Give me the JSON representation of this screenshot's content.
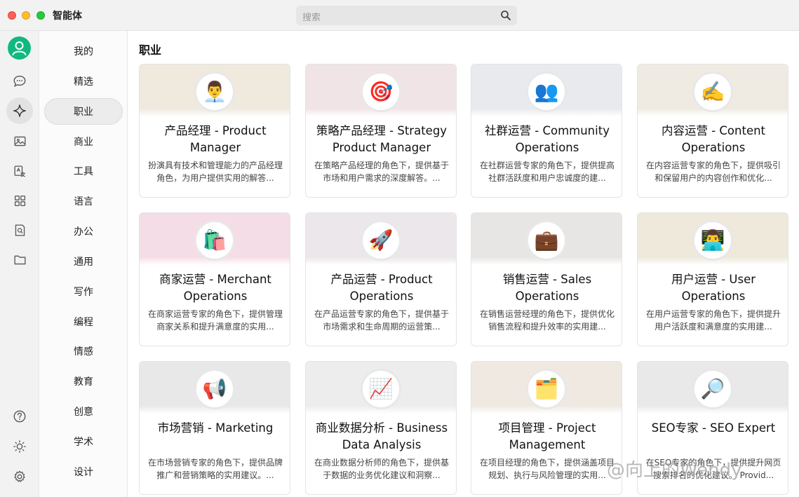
{
  "app": {
    "title": "智能体"
  },
  "search": {
    "placeholder": "搜索"
  },
  "rail": {
    "icons": [
      "avatar-icon",
      "chat-icon",
      "sparkle-icon",
      "image-icon",
      "translate-icon",
      "grid-icon",
      "search-doc-icon",
      "folder-icon",
      "help-icon",
      "sun-icon",
      "gear-icon"
    ],
    "accent": "#10b981"
  },
  "categories": [
    {
      "label": "我的"
    },
    {
      "label": "精选"
    },
    {
      "label": "职业",
      "active": true
    },
    {
      "label": "商业"
    },
    {
      "label": "工具"
    },
    {
      "label": "语言"
    },
    {
      "label": "办公"
    },
    {
      "label": "通用"
    },
    {
      "label": "写作"
    },
    {
      "label": "编程"
    },
    {
      "label": "情感"
    },
    {
      "label": "教育"
    },
    {
      "label": "创意"
    },
    {
      "label": "学术"
    },
    {
      "label": "设计"
    }
  ],
  "main": {
    "section_title": "职业"
  },
  "cards": [
    {
      "emoji": "👨‍💼",
      "banner": "#efe9de",
      "title": "产品经理 - Product Manager",
      "desc": "扮演具有技术和管理能力的产品经理角色，为用户提供实用的解答..."
    },
    {
      "emoji": "🎯",
      "banner": "#f1e4e6",
      "title": "策略产品经理 - Strategy Product Manager",
      "desc": "在策略产品经理的角色下，提供基于市场和用户需求的深度解答。..."
    },
    {
      "emoji": "👥",
      "banner": "#e8eaed",
      "title": "社群运营 - Community Operations",
      "desc": "在社群运营专家的角色下，提供提高社群活跃度和用户忠诚度的建..."
    },
    {
      "emoji": "✍️",
      "banner": "#efebe2",
      "title": "内容运营 - Content Operations",
      "desc": "在内容运营专家的角色下，提供吸引和保留用户的内容创作和优化..."
    },
    {
      "emoji": "🛍️",
      "banner": "#f4dde6",
      "title": "商家运营 - Merchant Operations",
      "desc": "在商家运营专家的角色下，提供管理商家关系和提升满意度的实用..."
    },
    {
      "emoji": "🚀",
      "banner": "#ece7ea",
      "title": "产品运营 - Product Operations",
      "desc": "在产品运营专家的角色下，提供基于市场需求和生命周期的运营策..."
    },
    {
      "emoji": "💼",
      "banner": "#e8e6e4",
      "title": "销售运营 - Sales Operations",
      "desc": "在销售运营经理的角色下，提供优化销售流程和提升效率的实用建..."
    },
    {
      "emoji": "👨‍💻",
      "banner": "#efe9dc",
      "title": "用户运营 - User Operations",
      "desc": "在用户运营专家的角色下，提供提升用户活跃度和满意度的实用建..."
    },
    {
      "emoji": "📢",
      "banner": "#e8e8e8",
      "title": "市场营销 - Marketing",
      "desc": "在市场营销专家的角色下，提供品牌推广和营销策略的实用建议。..."
    },
    {
      "emoji": "📈",
      "banner": "#ededed",
      "title": "商业数据分析 - Business Data Analysis",
      "desc": "在商业数据分析师的角色下，提供基于数据的业务优化建议和洞察..."
    },
    {
      "emoji": "🗂️",
      "banner": "#efe9e2",
      "title": "项目管理 - Project Management",
      "desc": "在项目经理的角色下，提供涵盖项目规划、执行与风险管理的实用..."
    },
    {
      "emoji": "🔎",
      "banner": "#e9e9e9",
      "title": "SEO专家 - SEO Expert",
      "desc": "在SEO专家的角色下，提供提升网页搜索排名的优化建议。 Provid..."
    }
  ],
  "watermark": "@向上的Wendy"
}
